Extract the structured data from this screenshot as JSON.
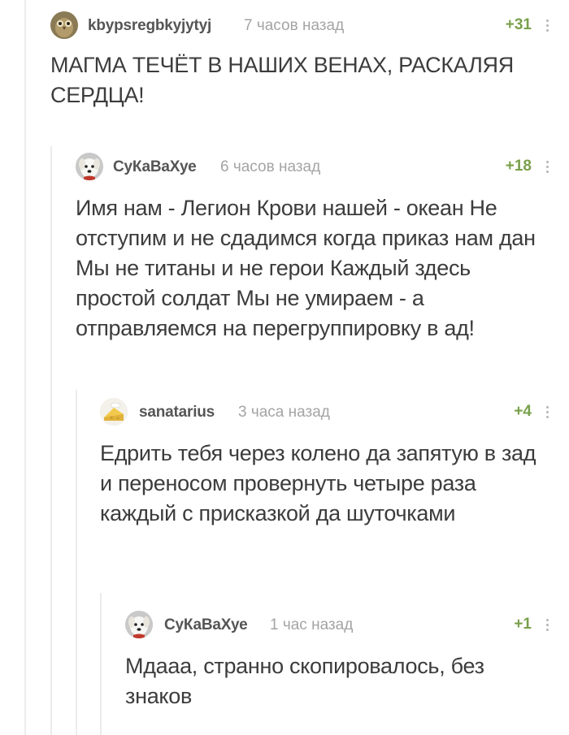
{
  "comments": [
    {
      "username": "kbypsregbkyjytyj",
      "time": "7 часов назад",
      "rating": "+31",
      "text": "МАГМА ТЕЧЁТ В НАШИХ ВЕНАХ, РАСКАЛЯЯ СЕРДЦА!",
      "avatar": "owl-avatar"
    },
    {
      "username": "СуКаВаХуе",
      "time": "6 часов назад",
      "rating": "+18",
      "text": "Имя нам - Легион Крови нашей - океан Не отступим и не сдадимся когда приказ нам дан Мы не титаны и не герои Каждый здесь простой солдат Мы не умираем - а отправляемся на перегруппировку в ад!",
      "avatar": "dog-avatar"
    },
    {
      "username": "sanatarius",
      "time": "3 часа назад",
      "rating": "+4",
      "text": "Едрить тебя через колено да запятую в зад и переносом провернуть четыре раза каждый с присказкой да шуточками",
      "avatar": "cheese-avatar"
    },
    {
      "username": "СуКаВаХуе",
      "time": "1 час назад",
      "rating": "+1",
      "text": "Мдааа, странно скопировалось, без знаков",
      "avatar": "dog-avatar"
    }
  ],
  "colors": {
    "rating": "#79a04a",
    "thread_line": "#ececec",
    "time": "#a4a4a4"
  }
}
